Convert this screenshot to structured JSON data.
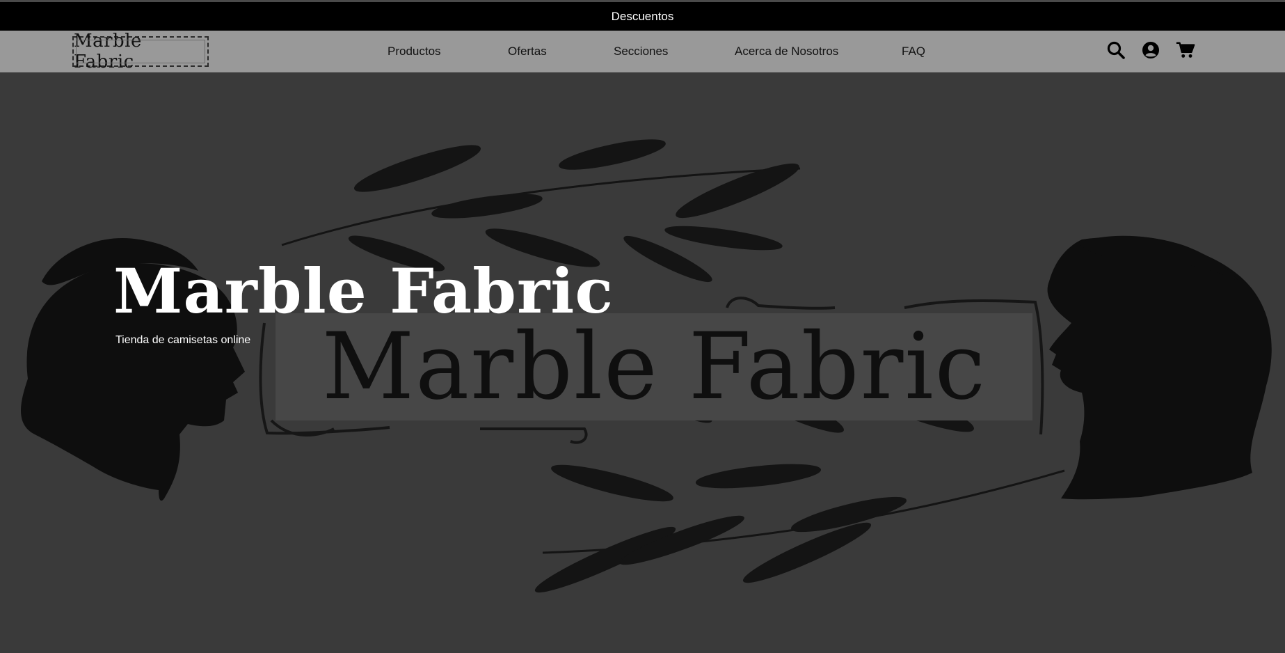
{
  "promo": {
    "label": "Descuentos"
  },
  "navbar": {
    "logo_text": "Marble Fabric",
    "links": [
      {
        "label": "Productos"
      },
      {
        "label": "Ofertas"
      },
      {
        "label": "Secciones"
      },
      {
        "label": "Acerca de Nosotros"
      },
      {
        "label": "FAQ"
      }
    ],
    "icons": [
      "search-icon",
      "user-account-icon",
      "shopping-cart-icon"
    ]
  },
  "hero": {
    "title": "Marble Fabric",
    "subtitle": "Tienda de camisetas online",
    "banner_text": "Marble Fabric"
  },
  "colors": {
    "promo_bg": "#000000",
    "navbar_bg": "#999999",
    "hero_bg": "#3a3a3a",
    "banner_bg": "#474747",
    "hero_title": "#ffffff"
  }
}
